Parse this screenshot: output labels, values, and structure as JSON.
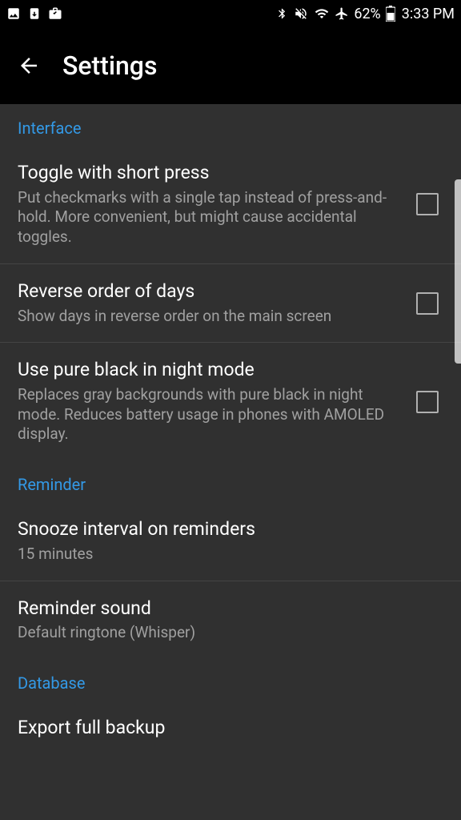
{
  "status": {
    "battery": "62%",
    "time": "3:33 PM"
  },
  "header": {
    "title": "Settings"
  },
  "sections": {
    "interface": {
      "label": "Interface",
      "items": {
        "toggle_short_press": {
          "title": "Toggle with short press",
          "desc": "Put checkmarks with a single tap instead of press-and-hold. More convenient, but might cause accidental toggles."
        },
        "reverse_days": {
          "title": "Reverse order of days",
          "desc": "Show days in reverse order on the main screen"
        },
        "pure_black": {
          "title": "Use pure black in night mode",
          "desc": "Replaces gray backgrounds with pure black in night mode. Reduces battery usage in phones with AMOLED display."
        }
      }
    },
    "reminder": {
      "label": "Reminder",
      "items": {
        "snooze": {
          "title": "Snooze interval on reminders",
          "desc": "15 minutes"
        },
        "sound": {
          "title": "Reminder sound",
          "desc": "Default ringtone (Whisper)"
        }
      }
    },
    "database": {
      "label": "Database",
      "items": {
        "export": {
          "title": "Export full backup"
        }
      }
    }
  }
}
